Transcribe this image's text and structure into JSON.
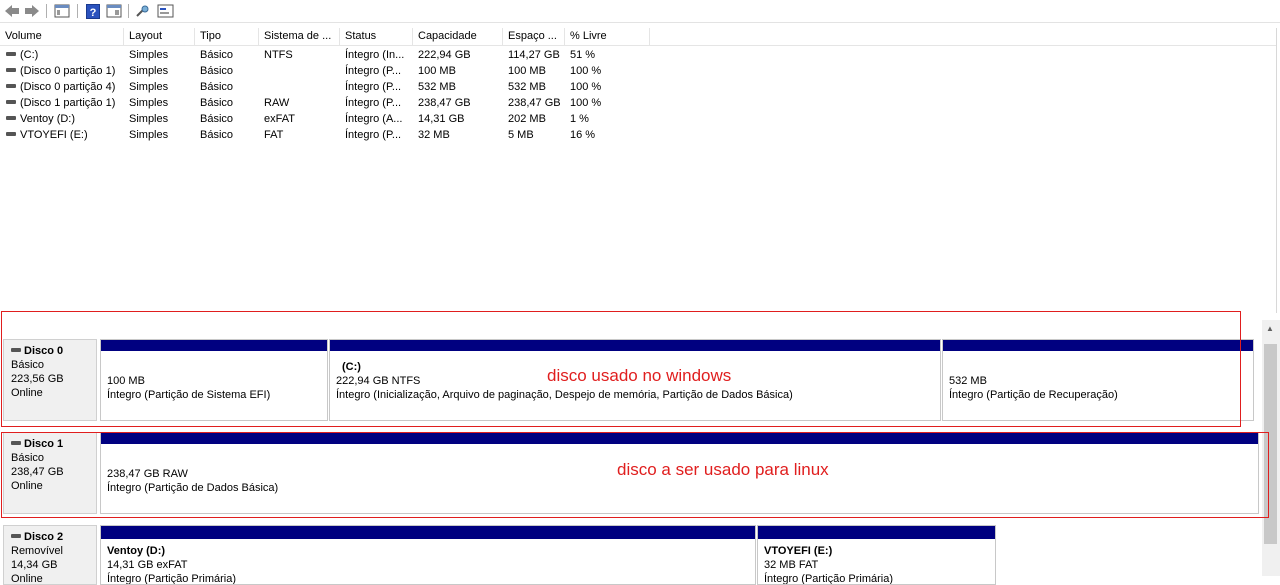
{
  "toolbar": {
    "icons": [
      "back-arrow-icon",
      "forward-arrow-icon",
      "console-tree-icon",
      "help-icon",
      "properties-icon",
      "connect-icon",
      "disk-view-icon"
    ]
  },
  "volume_list": {
    "columns": [
      "Volume",
      "Layout",
      "Tipo",
      "Sistema de ...",
      "Status",
      "Capacidade",
      "Espaço ...",
      "% Livre"
    ],
    "rows": [
      {
        "volume": "(C:)",
        "layout": "Simples",
        "tipo": "Básico",
        "fs": "NTFS",
        "status": "Íntegro (In...",
        "cap": "222,94 GB",
        "free": "114,27 GB",
        "pct": "51 %"
      },
      {
        "volume": "(Disco 0 partição 1)",
        "layout": "Simples",
        "tipo": "Básico",
        "fs": "",
        "status": "Íntegro (P...",
        "cap": "100 MB",
        "free": "100 MB",
        "pct": "100 %"
      },
      {
        "volume": "(Disco 0 partição 4)",
        "layout": "Simples",
        "tipo": "Básico",
        "fs": "",
        "status": "Íntegro (P...",
        "cap": "532 MB",
        "free": "532 MB",
        "pct": "100 %"
      },
      {
        "volume": "(Disco 1 partição 1)",
        "layout": "Simples",
        "tipo": "Básico",
        "fs": "RAW",
        "status": "Íntegro (P...",
        "cap": "238,47 GB",
        "free": "238,47 GB",
        "pct": "100 %"
      },
      {
        "volume": "Ventoy (D:)",
        "layout": "Simples",
        "tipo": "Básico",
        "fs": "exFAT",
        "status": "Íntegro (A...",
        "cap": "14,31 GB",
        "free": "202 MB",
        "pct": "1 %"
      },
      {
        "volume": "VTOYEFI (E:)",
        "layout": "Simples",
        "tipo": "Básico",
        "fs": "FAT",
        "status": "Íntegro (P...",
        "cap": "32 MB",
        "free": "5 MB",
        "pct": "16 %"
      }
    ]
  },
  "disks": [
    {
      "name": "Disco 0",
      "type": "Básico",
      "size": "223,56 GB",
      "state": "Online",
      "partitions": [
        {
          "title": "",
          "line1": "100 MB",
          "line2": "Íntegro (Partição de Sistema EFI)"
        },
        {
          "title": "(C:)",
          "line1": "222,94 GB NTFS",
          "line2": "Íntegro (Inicialização, Arquivo de paginação, Despejo de memória, Partição de Dados Básica)"
        },
        {
          "title": "",
          "line1": "532 MB",
          "line2": "Íntegro (Partição de Recuperação)"
        }
      ]
    },
    {
      "name": "Disco 1",
      "type": "Básico",
      "size": "238,47 GB",
      "state": "Online",
      "partitions": [
        {
          "title": "",
          "line1": "238,47 GB RAW",
          "line2": "Íntegro (Partição de Dados Básica)"
        }
      ]
    },
    {
      "name": "Disco 2",
      "type": "Removível",
      "size": "14,34 GB",
      "state": "Online",
      "partitions": [
        {
          "title": "Ventoy  (D:)",
          "line1": "14,31 GB exFAT",
          "line2": "Íntegro (Partição Primária)"
        },
        {
          "title": "VTOYEFI  (E:)",
          "line1": "32 MB FAT",
          "line2": "Íntegro (Partição Primária)"
        }
      ]
    }
  ],
  "annotations": {
    "disk0_note": "disco usado no windows",
    "disk1_note": "disco a ser usado para linux",
    "color": "#e01e1e"
  },
  "colors": {
    "partition_bar": "#000080",
    "label_bg": "#f0f0f0"
  }
}
